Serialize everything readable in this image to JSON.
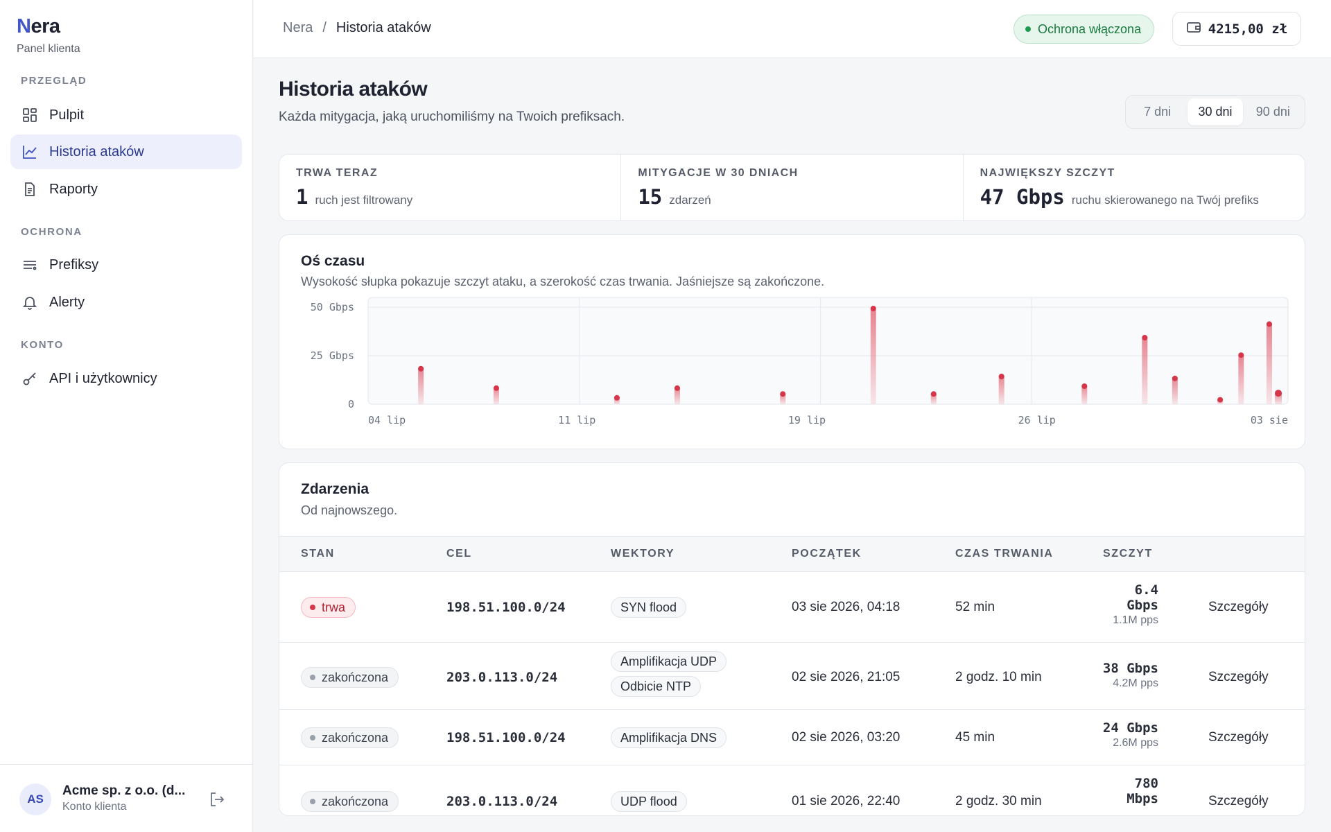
{
  "brand": {
    "name_first": "N",
    "name_rest": "era",
    "subtitle": "Panel klienta"
  },
  "sidebar": {
    "sections": [
      {
        "title": "PRZEGLĄD",
        "items": [
          {
            "label": "Pulpit",
            "icon": "grid-icon"
          },
          {
            "label": "Historia ataków",
            "icon": "chart-line-icon",
            "active": true
          },
          {
            "label": "Raporty",
            "icon": "document-icon"
          }
        ]
      },
      {
        "title": "OCHRONA",
        "items": [
          {
            "label": "Prefiksy",
            "icon": "list-icon"
          },
          {
            "label": "Alerty",
            "icon": "bell-icon"
          }
        ]
      },
      {
        "title": "KONTO",
        "items": [
          {
            "label": "API i użytkownicy",
            "icon": "key-icon"
          }
        ]
      }
    ],
    "user": {
      "initials": "AS",
      "name": "Acme sp. z o.o. (d...",
      "role": "Konto klienta"
    }
  },
  "header": {
    "breadcrumb": [
      "Nera",
      "/",
      "Historia ataków"
    ],
    "protection_badge": "Ochrona włączona",
    "balance": "4215,00 zł"
  },
  "page": {
    "title": "Historia ataków",
    "subtitle": "Każda mitygacja, jaką uruchomiliśmy na Twoich prefiksach.",
    "ranges": [
      "7 dni",
      "30 dni",
      "90 dni"
    ],
    "selected_range": "30 dni"
  },
  "stats": [
    {
      "label": "TRWA TERAZ",
      "value": "1",
      "text": "ruch jest filtrowany"
    },
    {
      "label": "MITYGACJE W 30 DNIACH",
      "value": "15",
      "text": "zdarzeń"
    },
    {
      "label": "NAJWIĘKSZY SZCZYT",
      "value": "47 Gbps",
      "text": "ruchu skierowanego na Twój prefiks"
    }
  ],
  "timeline": {
    "title": "Oś czasu",
    "subtitle": "Wysokość słupka pokazuje szczyt ataku, a szerokość czas trwania. Jaśniejsze są zakończone."
  },
  "chart_data": {
    "type": "bar",
    "x_axis": {
      "type": "date",
      "range": [
        "2026-07-04",
        "2026-08-03"
      ],
      "tick_labels": [
        "04 lip",
        "11 lip",
        "19 lip",
        "26 lip",
        "03 sie"
      ]
    },
    "y_axis": {
      "unit": "Gbps",
      "range": [
        0,
        55
      ],
      "tick_labels": [
        "50 Gbps",
        "25 Gbps",
        "0"
      ]
    },
    "grid": true,
    "colors": {
      "bar": "#e05a6b",
      "marker": "#d63649"
    },
    "points": [
      {
        "x": "2026-07-05 18:00",
        "peak_gbps": 19
      },
      {
        "x": "2026-07-08 06:00",
        "peak_gbps": 9
      },
      {
        "x": "2026-07-12 06:00",
        "peak_gbps": 4
      },
      {
        "x": "2026-07-14 06:00",
        "peak_gbps": 9
      },
      {
        "x": "2026-07-17 18:00",
        "peak_gbps": 6
      },
      {
        "x": "2026-07-20 18:00",
        "peak_gbps": 50
      },
      {
        "x": "2026-07-22 18:00",
        "peak_gbps": 6
      },
      {
        "x": "2026-07-25 00:00",
        "peak_gbps": 15
      },
      {
        "x": "2026-07-27 18:00",
        "peak_gbps": 10
      },
      {
        "x": "2026-07-29 18:00",
        "peak_gbps": 35
      },
      {
        "x": "2026-07-30 18:00",
        "peak_gbps": 14
      },
      {
        "x": "2026-08-01 06:00",
        "peak_gbps": 3
      },
      {
        "x": "2026-08-01 22:40",
        "peak_gbps": 26
      },
      {
        "x": "2026-08-02 21:05",
        "peak_gbps": 42
      },
      {
        "x": "2026-08-03 04:18",
        "peak_gbps": 6.4,
        "ongoing": true
      }
    ]
  },
  "events": {
    "title": "Zdarzenia",
    "subtitle": "Od najnowszego.",
    "columns": [
      "STAN",
      "CEL",
      "WEKTORY",
      "POCZĄTEK",
      "CZAS TRWANIA",
      "SZCZYT"
    ],
    "rows": [
      {
        "status": "trwa",
        "live": true,
        "target": "198.51.100.0/24",
        "vectors": [
          "SYN flood"
        ],
        "start": "03 sie 2026, 04:18",
        "duration": "52 min",
        "peak_l1": "6.4",
        "peak_l2": "Gbps",
        "pps": "1.1M pps",
        "action": "Szczegóły"
      },
      {
        "status": "zakończona",
        "live": false,
        "target": "203.0.113.0/24",
        "vectors": [
          "Amplifikacja UDP",
          "Odbicie NTP"
        ],
        "start": "02 sie 2026, 21:05",
        "duration": "2 godz. 10 min",
        "peak_l1": "38 Gbps",
        "peak_l2": "",
        "pps": "4.2M pps",
        "action": "Szczegóły"
      },
      {
        "status": "zakończona",
        "live": false,
        "target": "198.51.100.0/24",
        "vectors": [
          "Amplifikacja DNS"
        ],
        "start": "02 sie 2026, 03:20",
        "duration": "45 min",
        "peak_l1": "24 Gbps",
        "peak_l2": "",
        "pps": "2.6M pps",
        "action": "Szczegóły"
      },
      {
        "status": "zakończona",
        "live": false,
        "target": "203.0.113.0/24",
        "vectors": [
          "UDP flood"
        ],
        "start": "01 sie 2026, 22:40",
        "duration": "2 godz. 30 min",
        "peak_l1": "780",
        "peak_l2": "Mbps",
        "pps": "",
        "action": "Szczegóły"
      }
    ]
  }
}
